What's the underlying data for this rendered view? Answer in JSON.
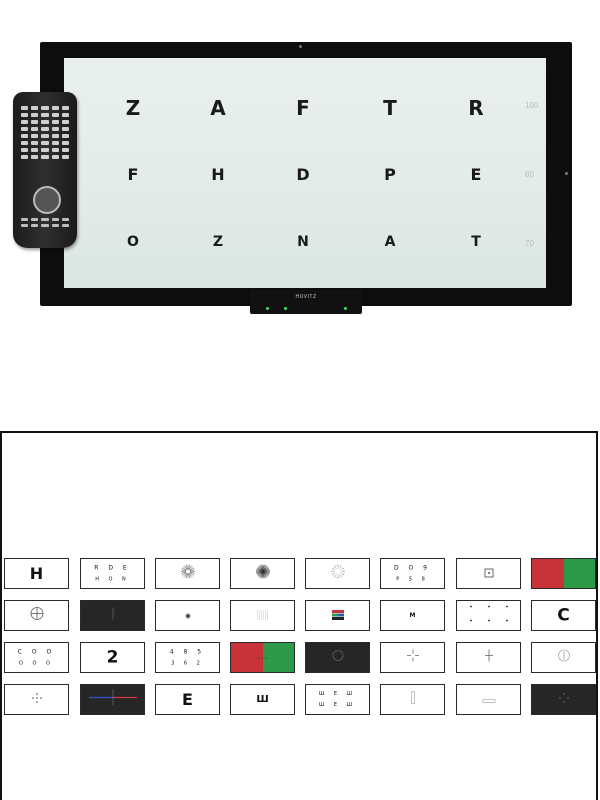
{
  "device": {
    "brand": "HUVITZ",
    "chart_rows": [
      {
        "letters": [
          "Z",
          "A",
          "F",
          "T",
          "R"
        ],
        "acuity": "100"
      },
      {
        "letters": [
          "F",
          "H",
          "D",
          "P",
          "E"
        ],
        "acuity": "80"
      },
      {
        "letters": [
          "O",
          "Z",
          "N",
          "A",
          "T"
        ],
        "acuity": "70"
      }
    ]
  },
  "library": {
    "rows": [
      [
        {
          "type": "letters",
          "text": "H",
          "size": 16
        },
        {
          "type": "letters",
          "text": "R D E",
          "sub": "H O N"
        },
        {
          "type": "icon",
          "icon": "starburst-icon"
        },
        {
          "type": "icon",
          "icon": "dense-starburst-icon"
        },
        {
          "type": "icon",
          "icon": "radial-dial-icon"
        },
        {
          "type": "letters",
          "text": "D O 9",
          "sub": "P 5 8"
        },
        {
          "type": "icon",
          "icon": "small-square-icon"
        },
        {
          "type": "duochrome"
        }
      ],
      [
        {
          "type": "icon",
          "icon": "circle-cross-icon"
        },
        {
          "type": "icon",
          "icon": "vertical-line-icon",
          "dark": true
        },
        {
          "type": "icon",
          "icon": "dot-icon"
        },
        {
          "type": "icon",
          "icon": "line-grid-icon"
        },
        {
          "type": "icon",
          "icon": "color-block-icon"
        },
        {
          "type": "letters",
          "text": "M",
          "size": 6
        },
        {
          "type": "icon",
          "icon": "dot-pattern-icon"
        },
        {
          "type": "letters",
          "text": "C",
          "size": 17
        }
      ],
      [
        {
          "type": "letters",
          "text": "C O O",
          "sub": "O O O"
        },
        {
          "type": "letters",
          "text": "2",
          "size": 17
        },
        {
          "type": "letters",
          "text": "4 8 5",
          "sub": "3 6 2"
        },
        {
          "type": "duochrome",
          "text": ". . ."
        },
        {
          "type": "icon",
          "icon": "dark-ring-icon",
          "dark": true
        },
        {
          "type": "icon",
          "icon": "crosshair-icon"
        },
        {
          "type": "icon",
          "icon": "plus-icon"
        },
        {
          "type": "icon",
          "icon": "ring-target-icon"
        }
      ],
      [
        {
          "type": "icon",
          "icon": "dot-cross-icon"
        },
        {
          "type": "icon",
          "icon": "red-blue-line-icon",
          "dark": true
        },
        {
          "type": "letters",
          "text": "E",
          "size": 16
        },
        {
          "type": "letters",
          "text": "Ш",
          "size": 10
        },
        {
          "type": "letters",
          "text": "Ш E Ш",
          "sub": "Ш E Ш",
          "small": true
        },
        {
          "type": "icon",
          "icon": "vertical-bar-icon"
        },
        {
          "type": "icon",
          "icon": "horizontal-bar-icon"
        },
        {
          "type": "icon",
          "icon": "dark-dots-icon",
          "dark": true
        }
      ]
    ]
  }
}
